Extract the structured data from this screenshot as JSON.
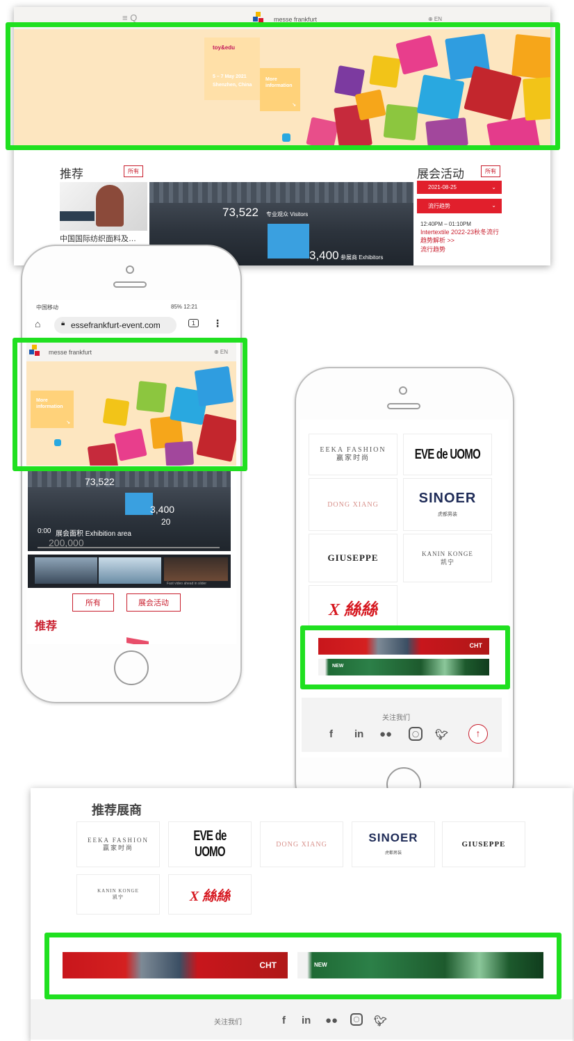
{
  "desktop": {
    "menu_icons": "≡  Q",
    "logo_text": "messe frankfurt",
    "lang": "⊕ EN",
    "banner": {
      "brand": "toy&edu",
      "dates": "5 – 7 May 2021",
      "location": "Shenzhen, China",
      "more": "More information"
    },
    "recommend_title": "推荐",
    "recommend_tag": "所有",
    "video_caption": "中国国际纺织面料及…",
    "stat_visitors": "73,522",
    "stat_visitors_label": "专业观众 Visitors",
    "stat_exhibitors": "3,400",
    "stat_exhibitors_label": "参展商 Exhibitors",
    "events_title": "展会活动",
    "events_tag": "所有",
    "date_dropdown": "2021-08-25",
    "category_dropdown": "流行趋势",
    "event_time": "12:40PM – 01:10PM",
    "event_title": "Intertextile 2022-23秋冬流行趋势解析 >>",
    "event_category": "流行趋势"
  },
  "phone1": {
    "status_left": "中国移动",
    "status_right": "85% 12:21",
    "url": "essefrankfurt-event.com",
    "tab_count": "1",
    "logo_text": "messe frankfurt",
    "lang": "⊕ EN",
    "banner_more": "More information",
    "stat_visitors": "73,522",
    "stat_exhibitors": "3,400",
    "stat_area_label": "20",
    "video_time": "0:00",
    "video_label": "展会面积 Exhibition area",
    "video_area": "200,000",
    "thumb_caption": "Fast video ahead in slider",
    "btn_all": "所有",
    "btn_events": "展会活动",
    "section_title": "推荐"
  },
  "brands": [
    {
      "name": "EEKA FASHION",
      "sub": "赢家时尚"
    },
    {
      "name": "EVE de UOMO"
    },
    {
      "name": "DONG XIANG"
    },
    {
      "name": "SINOER",
      "sub": "虎都男装"
    },
    {
      "name": "GIUSEPPE"
    },
    {
      "name": "KANIN KONGE",
      "sub": "凯宁"
    },
    {
      "name": "X 絲絲"
    }
  ],
  "phone2": {
    "follow_label": "关注我们",
    "ad_red_text": "CHT",
    "ad_green_text": "NEW"
  },
  "desktop2": {
    "title": "推荐展商",
    "follow_label": "关注我们",
    "ad_red_text": "CHT",
    "ad_green_text": "NEW"
  },
  "social_icons": [
    "f",
    "in",
    "wechat",
    "instagram",
    "twitter"
  ],
  "colors": {
    "highlight": "#20e020",
    "accent_red": "#c81d2c",
    "banner_bg": "#fde6c0"
  }
}
